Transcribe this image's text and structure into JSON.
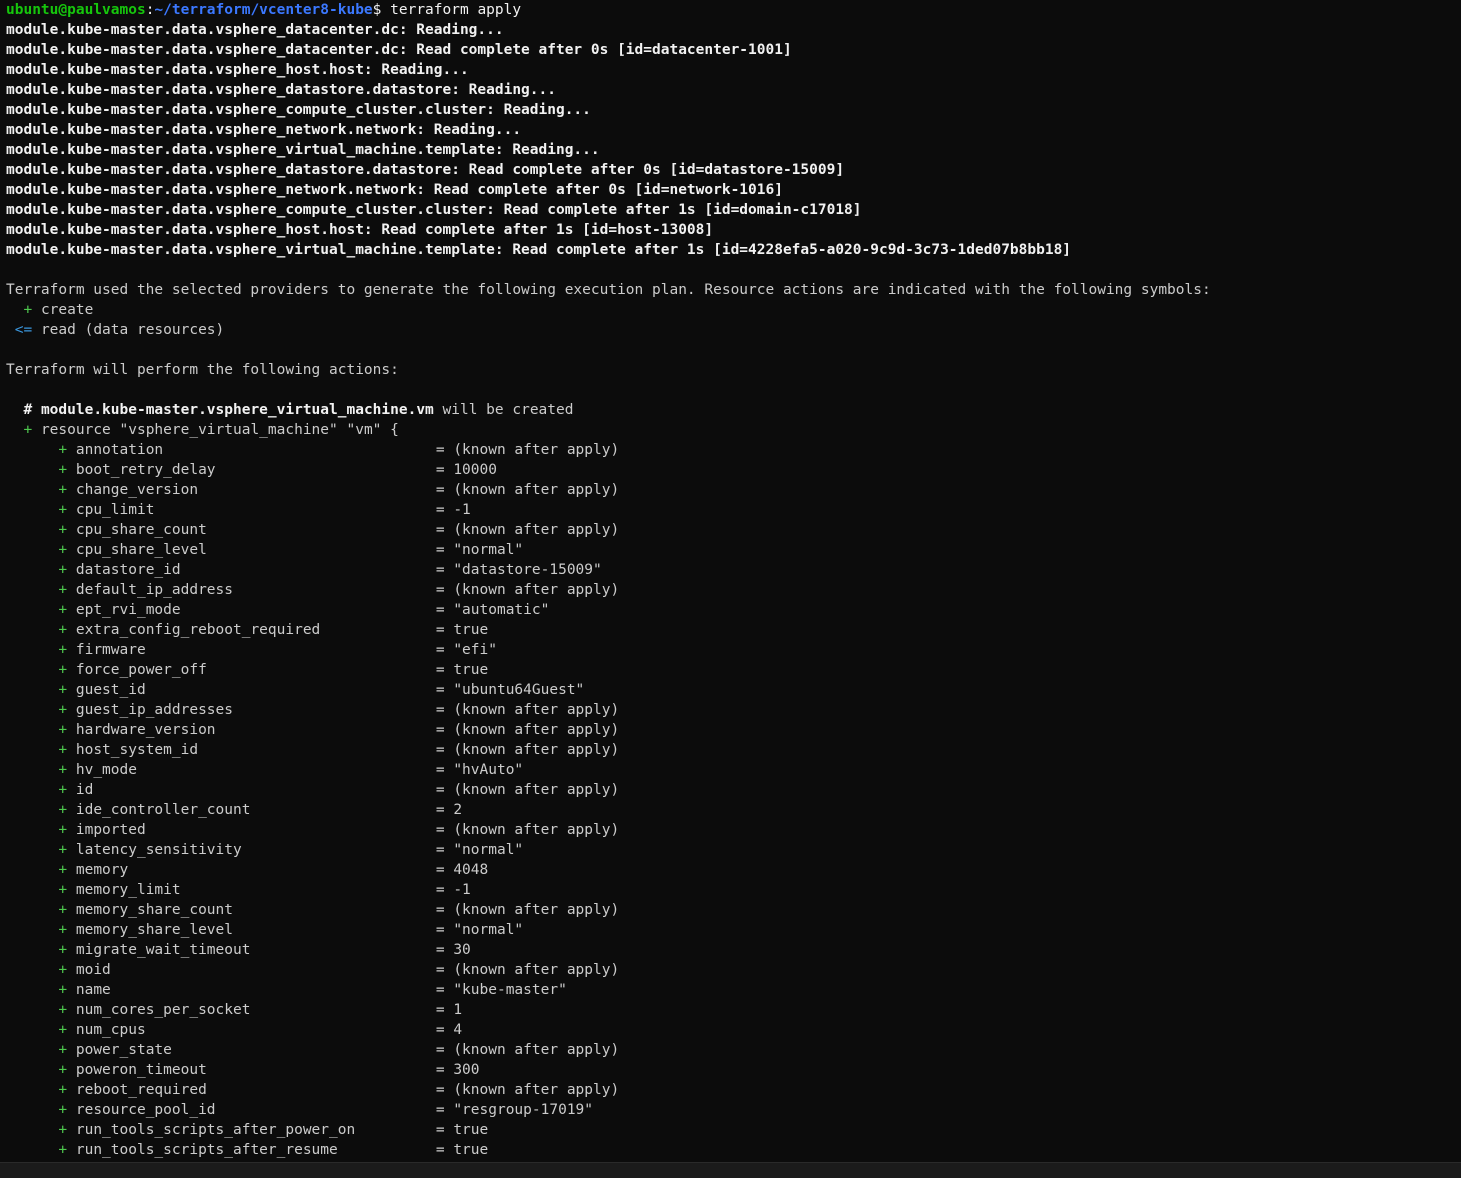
{
  "prompt": {
    "user": "ubuntu@paulvamos",
    "sep": ":",
    "path": "~/terraform/vcenter8-kube",
    "symbol": "$ ",
    "command": "terraform apply"
  },
  "data_reads": [
    "module.kube-master.data.vsphere_datacenter.dc: Reading...",
    "module.kube-master.data.vsphere_datacenter.dc: Read complete after 0s [id=datacenter-1001]",
    "module.kube-master.data.vsphere_host.host: Reading...",
    "module.kube-master.data.vsphere_datastore.datastore: Reading...",
    "module.kube-master.data.vsphere_compute_cluster.cluster: Reading...",
    "module.kube-master.data.vsphere_network.network: Reading...",
    "module.kube-master.data.vsphere_virtual_machine.template: Reading...",
    "module.kube-master.data.vsphere_datastore.datastore: Read complete after 0s [id=datastore-15009]",
    "module.kube-master.data.vsphere_network.network: Read complete after 0s [id=network-1016]",
    "module.kube-master.data.vsphere_compute_cluster.cluster: Read complete after 1s [id=domain-c17018]",
    "module.kube-master.data.vsphere_host.host: Read complete after 1s [id=host-13008]",
    "module.kube-master.data.vsphere_virtual_machine.template: Read complete after 1s [id=4228efa5-a020-9c9d-3c73-1ded07b8bb18]"
  ],
  "plan_intro": "Terraform used the selected providers to generate the following execution plan. Resource actions are indicated with the following symbols:",
  "symbols": {
    "create_sym": "+",
    "create_label": "create",
    "read_sym": "<=",
    "read_label": "read (data resources)"
  },
  "perform_intro": "Terraform will perform the following actions:",
  "resource": {
    "comment_hash": "#",
    "address": "module.kube-master.vsphere_virtual_machine.vm",
    "comment_suffix": "will be created",
    "plus": "+",
    "declaration": "resource \"vsphere_virtual_machine\" \"vm\" {"
  },
  "attributes": [
    {
      "name": "annotation",
      "value": "(known after apply)"
    },
    {
      "name": "boot_retry_delay",
      "value": "10000"
    },
    {
      "name": "change_version",
      "value": "(known after apply)"
    },
    {
      "name": "cpu_limit",
      "value": "-1"
    },
    {
      "name": "cpu_share_count",
      "value": "(known after apply)"
    },
    {
      "name": "cpu_share_level",
      "value": "\"normal\""
    },
    {
      "name": "datastore_id",
      "value": "\"datastore-15009\""
    },
    {
      "name": "default_ip_address",
      "value": "(known after apply)"
    },
    {
      "name": "ept_rvi_mode",
      "value": "\"automatic\""
    },
    {
      "name": "extra_config_reboot_required",
      "value": "true"
    },
    {
      "name": "firmware",
      "value": "\"efi\""
    },
    {
      "name": "force_power_off",
      "value": "true"
    },
    {
      "name": "guest_id",
      "value": "\"ubuntu64Guest\""
    },
    {
      "name": "guest_ip_addresses",
      "value": "(known after apply)"
    },
    {
      "name": "hardware_version",
      "value": "(known after apply)"
    },
    {
      "name": "host_system_id",
      "value": "(known after apply)"
    },
    {
      "name": "hv_mode",
      "value": "\"hvAuto\""
    },
    {
      "name": "id",
      "value": "(known after apply)"
    },
    {
      "name": "ide_controller_count",
      "value": "2"
    },
    {
      "name": "imported",
      "value": "(known after apply)"
    },
    {
      "name": "latency_sensitivity",
      "value": "\"normal\""
    },
    {
      "name": "memory",
      "value": "4048"
    },
    {
      "name": "memory_limit",
      "value": "-1"
    },
    {
      "name": "memory_share_count",
      "value": "(known after apply)"
    },
    {
      "name": "memory_share_level",
      "value": "\"normal\""
    },
    {
      "name": "migrate_wait_timeout",
      "value": "30"
    },
    {
      "name": "moid",
      "value": "(known after apply)"
    },
    {
      "name": "name",
      "value": "\"kube-master\""
    },
    {
      "name": "num_cores_per_socket",
      "value": "1"
    },
    {
      "name": "num_cpus",
      "value": "4"
    },
    {
      "name": "power_state",
      "value": "(known after apply)"
    },
    {
      "name": "poweron_timeout",
      "value": "300"
    },
    {
      "name": "reboot_required",
      "value": "(known after apply)"
    },
    {
      "name": "resource_pool_id",
      "value": "\"resgroup-17019\""
    },
    {
      "name": "run_tools_scripts_after_power_on",
      "value": "true"
    },
    {
      "name": "run_tools_scripts_after_resume",
      "value": "true"
    }
  ],
  "colors": {
    "background": "#0c0c0c",
    "text": "#cccccc",
    "prompt_user": "#16c60c",
    "prompt_path": "#3b78ff",
    "plus": "#4ec94e",
    "read_symbol": "#3a96dd"
  }
}
